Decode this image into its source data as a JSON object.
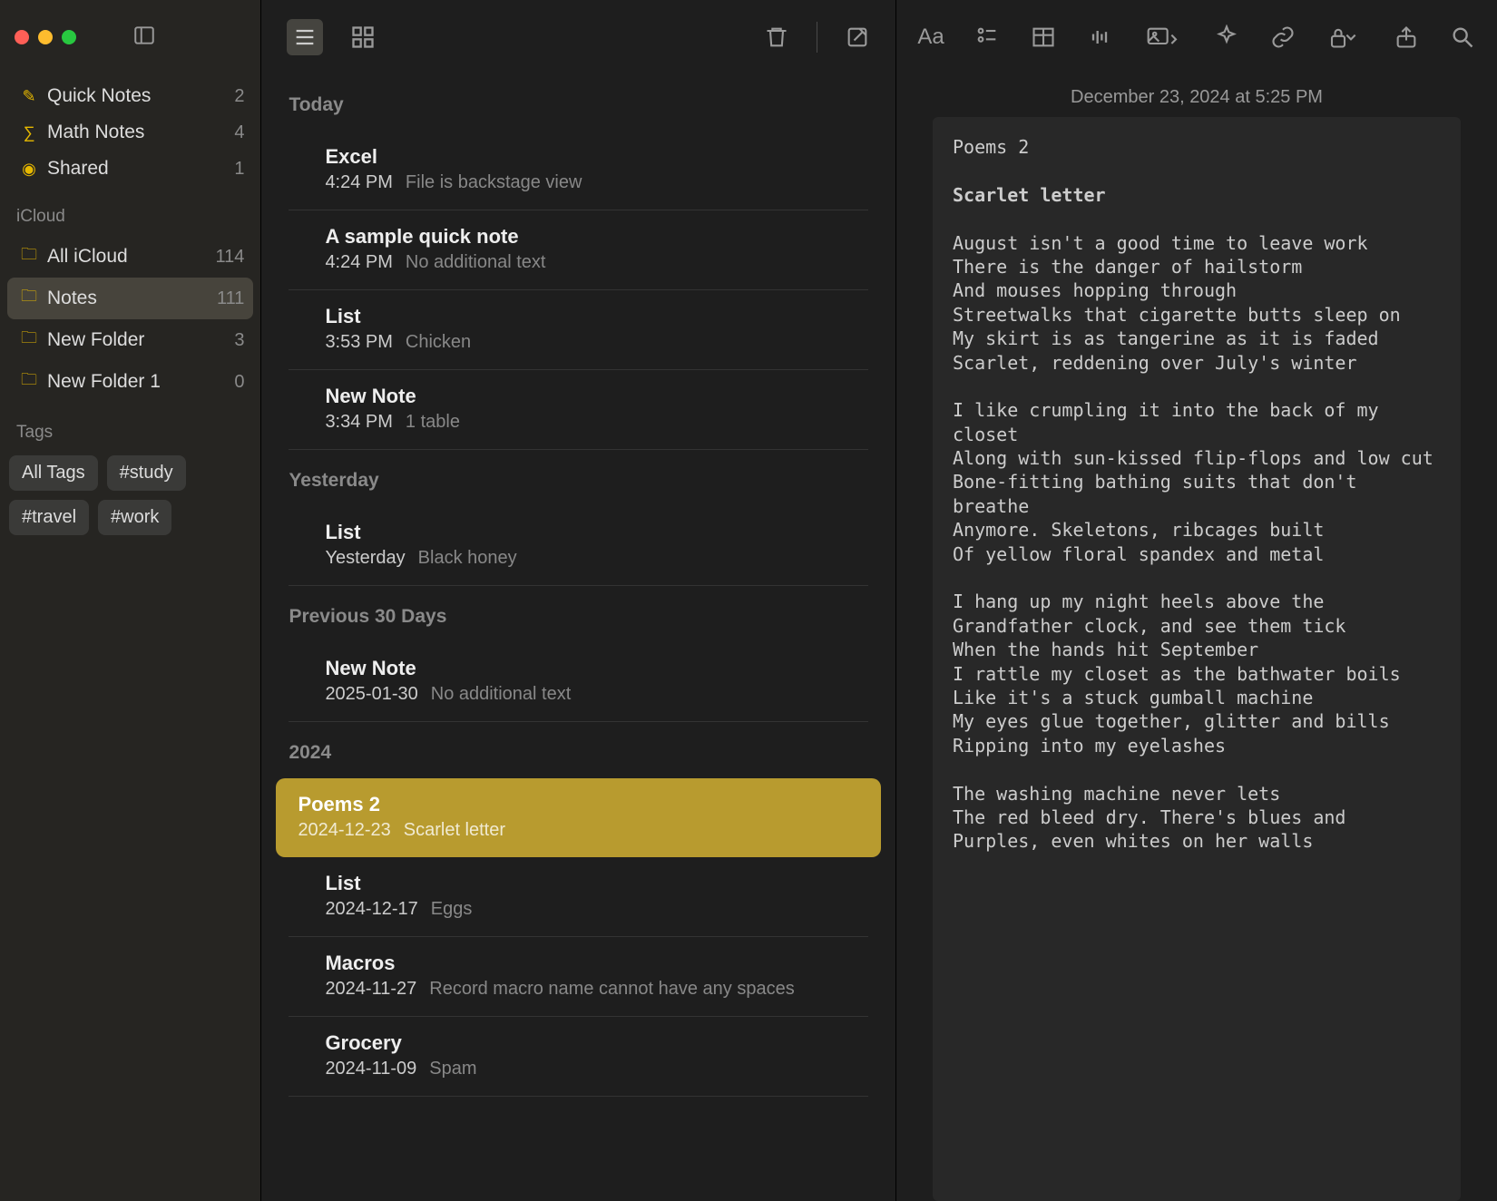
{
  "sidebar": {
    "smartFolders": [
      {
        "icon": "quick",
        "label": "Quick Notes",
        "count": "2"
      },
      {
        "icon": "math",
        "label": "Math Notes",
        "count": "4"
      },
      {
        "icon": "shared",
        "label": "Shared",
        "count": "1"
      }
    ],
    "icloudHeader": "iCloud",
    "folders": [
      {
        "label": "All iCloud",
        "count": "114",
        "selected": false
      },
      {
        "label": "Notes",
        "count": "111",
        "selected": true
      },
      {
        "label": "New Folder",
        "count": "3",
        "selected": false
      },
      {
        "label": "New Folder 1",
        "count": "0",
        "selected": false
      }
    ],
    "tagsHeader": "Tags",
    "tags": [
      "All Tags",
      "#study",
      "#travel",
      "#work"
    ]
  },
  "list": {
    "sections": [
      {
        "header": "Today",
        "items": [
          {
            "title": "Excel",
            "meta": "4:24 PM",
            "preview": "File is backstage view"
          },
          {
            "title": "A sample quick note",
            "meta": "4:24 PM",
            "preview": "No additional text"
          },
          {
            "title": "List",
            "meta": "3:53 PM",
            "preview": "Chicken"
          },
          {
            "title": "New Note",
            "meta": "3:34 PM",
            "preview": "1 table"
          }
        ]
      },
      {
        "header": "Yesterday",
        "items": [
          {
            "title": "List",
            "meta": "Yesterday",
            "preview": "Black honey"
          }
        ]
      },
      {
        "header": "Previous 30 Days",
        "items": [
          {
            "title": "New Note",
            "meta": "2025-01-30",
            "preview": "No additional text"
          }
        ]
      },
      {
        "header": "2024",
        "items": [
          {
            "title": "Poems 2",
            "meta": "2024-12-23",
            "preview": "Scarlet letter",
            "selected": true
          },
          {
            "title": "List",
            "meta": "2024-12-17",
            "preview": "Eggs"
          },
          {
            "title": "Macros",
            "meta": "2024-11-27",
            "preview": "Record macro name cannot have any spaces"
          },
          {
            "title": "Grocery",
            "meta": "2024-11-09",
            "preview": "Spam"
          }
        ]
      }
    ]
  },
  "editor": {
    "dateline": "December 23, 2024 at 5:25 PM",
    "title": "Poems 2",
    "subtitle": "Scarlet letter",
    "body": "August isn't a good time to leave work\nThere is the danger of hailstorm\nAnd mouses hopping through\nStreetwalks that cigarette butts sleep on\nMy skirt is as tangerine as it is faded\nScarlet, reddening over July's winter\n\nI like crumpling it into the back of my closet\nAlong with sun-kissed flip-flops and low cut\nBone-fitting bathing suits that don't breathe\nAnymore. Skeletons, ribcages built\nOf yellow floral spandex and metal\n\nI hang up my night heels above the\nGrandfather clock, and see them tick\nWhen the hands hit September\nI rattle my closet as the bathwater boils\nLike it's a stuck gumball machine\nMy eyes glue together, glitter and bills\nRipping into my eyelashes\n\nThe washing machine never lets\nThe red bleed dry. There's blues and\nPurples, even whites on her walls"
  }
}
